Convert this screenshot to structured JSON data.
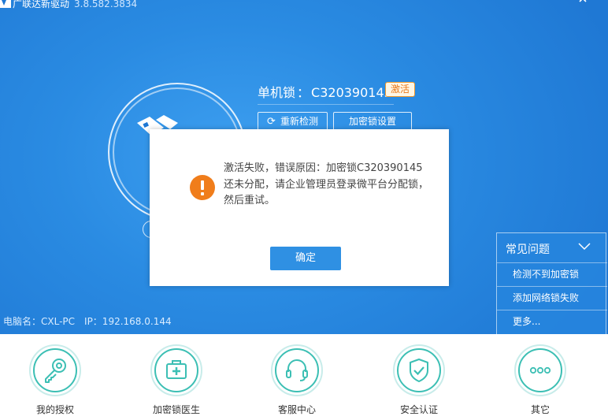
{
  "window": {
    "title": "广联达新驱动",
    "version": "3.8.582.3834",
    "minimize_icon": "minimize-icon",
    "close_icon": "close-icon"
  },
  "lock": {
    "type_label": "单机锁",
    "separator": "：",
    "id": "C320390145",
    "activate_badge": "激活",
    "redetect_label": "重新检测",
    "settings_label": "加密锁设置"
  },
  "pc": {
    "name_label": "电脑名：CXL-PC",
    "ip_label": "IP：192.168.0.144"
  },
  "faq": {
    "title": "常见问题",
    "items": [
      {
        "label": "检测不到加密锁"
      },
      {
        "label": "添加网络锁失败"
      },
      {
        "label": "更多..."
      }
    ]
  },
  "toolbar": {
    "items": [
      {
        "label": "我的授权",
        "icon": "key-icon"
      },
      {
        "label": "加密锁医生",
        "icon": "medical-kit-icon"
      },
      {
        "label": "客服中心",
        "icon": "headset-icon"
      },
      {
        "label": "安全认证",
        "icon": "shield-check-icon"
      },
      {
        "label": "其它",
        "icon": "more-icon"
      }
    ]
  },
  "dialog": {
    "message": "激活失败，错误原因：加密锁C320390145还未分配，请企业管理员登录微平台分配锁，然后重试。",
    "ok_label": "确定"
  },
  "colors": {
    "primary_blue": "#2a8be2",
    "teal_accent": "#3cbfb4",
    "warning_orange": "#f07d1b",
    "badge_orange": "#e8781a"
  }
}
